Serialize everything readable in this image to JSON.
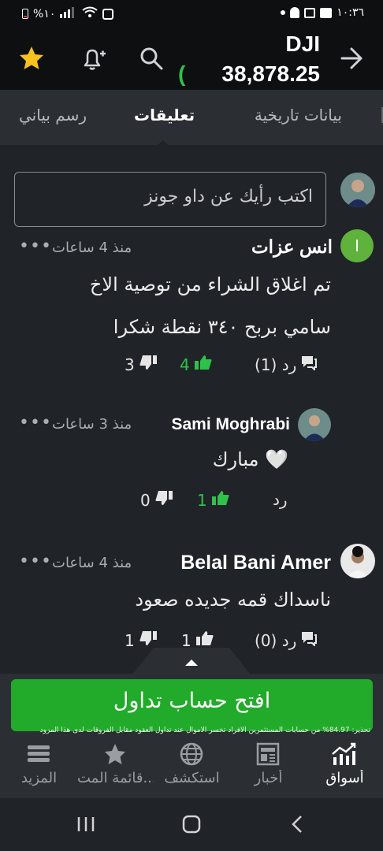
{
  "status_bar": {
    "battery": "%١٠",
    "time": "١٠:٣٦"
  },
  "header": {
    "symbol": "DJI",
    "price": "38,878.25",
    "change_fragment": "(",
    "icons": [
      "back-arrow-icon",
      "search-icon",
      "add-alert-icon",
      "star-icon"
    ]
  },
  "tabs": [
    {
      "label": "بيانات تاريخية",
      "active": false
    },
    {
      "label": "تعليقات",
      "active": true
    },
    {
      "label": "رسم بياني",
      "active": false
    }
  ],
  "composer": {
    "placeholder": "اكتب رأيك عن داو جونز"
  },
  "posts": [
    {
      "author": "انس عزات",
      "avatar_letter": "ا",
      "time": "منذ 4 ساعات",
      "body_lines": [
        "تم اغلاق الشراء من توصية الاخ",
        "سامي بربح ٣٤٠ نقطة شكرا"
      ],
      "reply": "رد (1)",
      "likes": "4",
      "dislikes": "3"
    },
    {
      "author": "Sami Moghrabi",
      "time": "منذ 3 ساعات",
      "body_lines": [
        "مبارك 🤍"
      ],
      "reply": "رد",
      "likes": "1",
      "dislikes": "0"
    },
    {
      "author": "Belal Bani Amer",
      "time": "منذ 4 ساعات",
      "body_lines": [
        "ناسداك قمه جديده صعود"
      ],
      "reply": "رد (0)",
      "likes": "1",
      "dislikes": "1"
    }
  ],
  "cta": {
    "label": "افتح حساب تداول",
    "disclaimer": "تحذير: 84.97% من حسابات المستثمرين الأفراد تخسر الأموال عند تداول العقود مقابل الفروقات لدى هذا المزود"
  },
  "bottom_nav": [
    {
      "label": "أسواق",
      "icon": "markets-icon",
      "active": true
    },
    {
      "label": "أخبار",
      "icon": "news-icon",
      "active": false
    },
    {
      "label": "استكشف",
      "icon": "globe-icon",
      "active": false
    },
    {
      "label": "قائمة المت...",
      "icon": "star-icon",
      "active": false
    },
    {
      "label": "المزيد",
      "icon": "menu-icon",
      "active": false
    }
  ],
  "colors": {
    "accent_green": "#2ec24a",
    "cta_green": "#22ab2a",
    "star": "#f6c21b",
    "background": "#202327"
  }
}
